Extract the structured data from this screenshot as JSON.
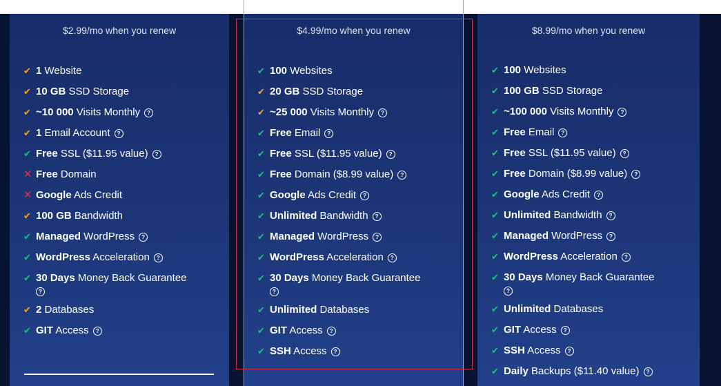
{
  "plans": [
    {
      "renew_text": "$2.99/mo when you renew",
      "features": [
        {
          "bold": "1",
          "text": " Website",
          "mark": "check-orange",
          "help": false
        },
        {
          "bold": "10 GB",
          "text": " SSD Storage",
          "mark": "check-orange",
          "help": false
        },
        {
          "bold": "~10 000",
          "text": " Visits Monthly",
          "mark": "check-orange",
          "help": true
        },
        {
          "bold": "1",
          "text": " Email Account",
          "mark": "check-orange",
          "help": true
        },
        {
          "bold": "Free",
          "text": " SSL ($11.95 value)",
          "mark": "check-green",
          "help": true
        },
        {
          "bold": "Free",
          "text": " Domain",
          "mark": "cross-red",
          "help": false
        },
        {
          "bold": "Google",
          "text": " Ads Credit",
          "mark": "cross-red",
          "help": false
        },
        {
          "bold": "100 GB",
          "text": " Bandwidth",
          "mark": "check-orange",
          "help": false
        },
        {
          "bold": "Managed",
          "text": " WordPress",
          "mark": "check-green",
          "help": true
        },
        {
          "bold": "WordPress",
          "text": " Acceleration",
          "mark": "check-green",
          "help": true
        },
        {
          "bold": "30 Days",
          "text": " Money Back Guarantee",
          "mark": "check-green",
          "help": true,
          "help_block": true
        },
        {
          "bold": "2",
          "text": " Databases",
          "mark": "check-orange",
          "help": false
        },
        {
          "bold": "GIT",
          "text": " Access",
          "mark": "check-green",
          "help": true
        }
      ]
    },
    {
      "renew_text": "$4.99/mo when you renew",
      "features": [
        {
          "bold": "100",
          "text": " Websites",
          "mark": "check-green",
          "help": false
        },
        {
          "bold": "20 GB",
          "text": " SSD Storage",
          "mark": "check-orange",
          "help": false
        },
        {
          "bold": "~25 000",
          "text": " Visits Monthly",
          "mark": "check-orange",
          "help": true
        },
        {
          "bold": "Free",
          "text": " Email",
          "mark": "check-green",
          "help": true
        },
        {
          "bold": "Free",
          "text": " SSL ($11.95 value)",
          "mark": "check-green",
          "help": true
        },
        {
          "bold": "Free",
          "text": " Domain ($8.99 value)",
          "mark": "check-green",
          "help": true
        },
        {
          "bold": "Google",
          "text": " Ads Credit",
          "mark": "check-green",
          "help": true
        },
        {
          "bold": "Unlimited",
          "text": " Bandwidth",
          "mark": "check-green",
          "help": true
        },
        {
          "bold": "Managed",
          "text": " WordPress",
          "mark": "check-green",
          "help": true
        },
        {
          "bold": "WordPress",
          "text": " Acceleration",
          "mark": "check-green",
          "help": true
        },
        {
          "bold": "30 Days",
          "text": " Money Back Guarantee",
          "mark": "check-green",
          "help": true,
          "help_block": true
        },
        {
          "bold": "Unlimited",
          "text": " Databases",
          "mark": "check-green",
          "help": false
        },
        {
          "bold": "GIT",
          "text": " Access",
          "mark": "check-green",
          "help": true
        },
        {
          "bold": "SSH",
          "text": " Access",
          "mark": "check-green",
          "help": true
        }
      ]
    },
    {
      "renew_text": "$8.99/mo when you renew",
      "features": [
        {
          "bold": "100",
          "text": " Websites",
          "mark": "check-green",
          "help": false
        },
        {
          "bold": "100 GB",
          "text": " SSD Storage",
          "mark": "check-green",
          "help": false
        },
        {
          "bold": "~100 000",
          "text": " Visits Monthly",
          "mark": "check-green",
          "help": true
        },
        {
          "bold": "Free",
          "text": " Email",
          "mark": "check-green",
          "help": true
        },
        {
          "bold": "Free",
          "text": " SSL ($11.95 value)",
          "mark": "check-green",
          "help": true
        },
        {
          "bold": "Free",
          "text": " Domain ($8.99 value)",
          "mark": "check-green",
          "help": true
        },
        {
          "bold": "Google",
          "text": " Ads Credit",
          "mark": "check-green",
          "help": true
        },
        {
          "bold": "Unlimited",
          "text": " Bandwidth",
          "mark": "check-green",
          "help": true
        },
        {
          "bold": "Managed",
          "text": " WordPress",
          "mark": "check-green",
          "help": true
        },
        {
          "bold": "WordPress",
          "text": " Acceleration",
          "mark": "check-green",
          "help": true
        },
        {
          "bold": "30 Days",
          "text": " Money Back Guarantee",
          "mark": "check-green",
          "help": true,
          "help_block": true
        },
        {
          "bold": "Unlimited",
          "text": " Databases",
          "mark": "check-green",
          "help": false
        },
        {
          "bold": "GIT",
          "text": " Access",
          "mark": "check-green",
          "help": true
        },
        {
          "bold": "SSH",
          "text": " Access",
          "mark": "check-green",
          "help": true
        },
        {
          "bold": "Daily",
          "text": " Backups ($11.40 value)",
          "mark": "check-green",
          "help": true
        }
      ]
    }
  ],
  "icons": {
    "check": "check-icon",
    "cross": "cross-icon",
    "help": "help-circle-icon"
  },
  "colors": {
    "card_bg": "#1c3678",
    "page_bg": "#081231",
    "check_green": "#19c37d",
    "check_orange": "#f5a623",
    "cross_red": "#e0334f",
    "highlight_border": "#d8334a"
  }
}
